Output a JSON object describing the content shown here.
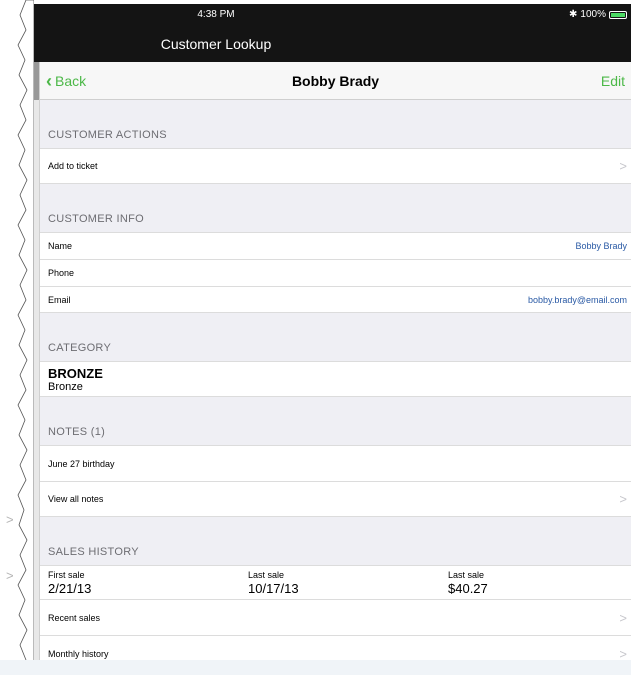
{
  "status": {
    "time": "4:38 PM",
    "battery": "100%"
  },
  "app": {
    "title": "Customer Lookup"
  },
  "nav": {
    "back": "Back",
    "title": "Bobby Brady",
    "edit": "Edit"
  },
  "actions": {
    "header": "CUSTOMER ACTIONS",
    "add_to_ticket": "Add to ticket"
  },
  "info": {
    "header": "CUSTOMER INFO",
    "name_label": "Name",
    "name_value": "Bobby Brady",
    "phone_label": "Phone",
    "email_label": "Email",
    "email_value": "bobby.brady@email.com"
  },
  "category": {
    "header": "CATEGORY",
    "title": "BRONZE",
    "subtitle": "Bronze"
  },
  "notes": {
    "header": "NOTES (1)",
    "note1": "June 27 birthday",
    "view_all": "View all notes"
  },
  "sales": {
    "header": "SALES HISTORY",
    "first_label": "First sale",
    "first_value": "2/21/13",
    "last_label": "Last sale",
    "last_value": "10/17/13",
    "last_amount_label": "Last sale",
    "last_amount_value": "$40.27",
    "recent": "Recent sales",
    "monthly": "Monthly history"
  },
  "colors": {
    "accent": "#4cb848",
    "link": "#2a5aa5",
    "bar": "#141414",
    "bg": "#efeff4"
  },
  "icons": {
    "back": "chevron-left-icon",
    "row": "chevron-right-icon",
    "bluetooth": "bluetooth-icon",
    "battery": "battery-icon"
  }
}
